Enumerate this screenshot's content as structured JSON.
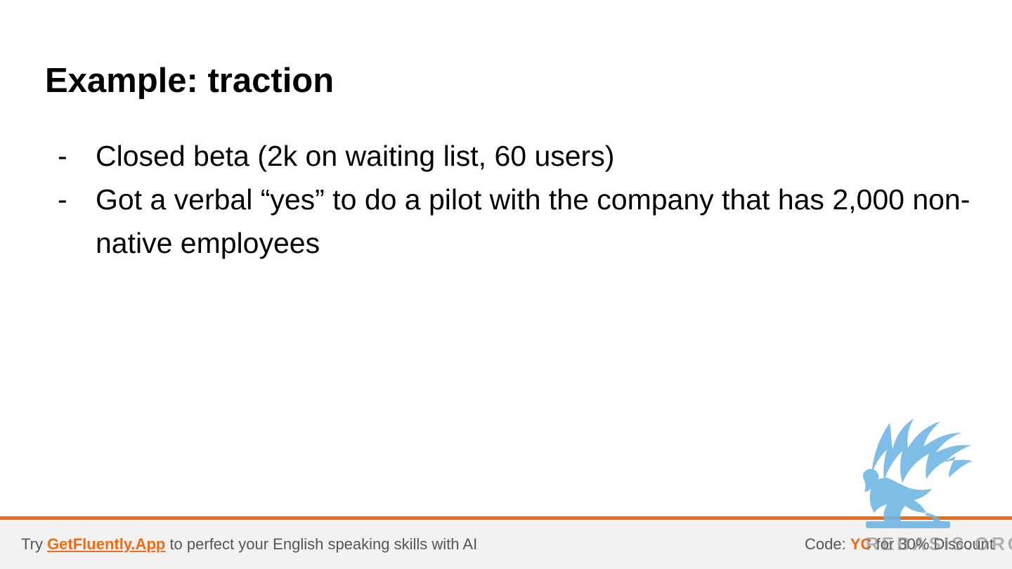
{
  "slide": {
    "title": "Example: traction",
    "bullets": [
      {
        "marker": "-",
        "text": "Closed beta (2k on waiting list, 60 users)"
      },
      {
        "marker": "-",
        "text": "Got a verbal “yes” to do a pilot with the company that has 2,000 non-native employees"
      }
    ]
  },
  "footer": {
    "left_prefix": "Try ",
    "link_text": "GetFluently.App",
    "left_suffix": " to perfect your English speaking skills with AI",
    "right_prefix": "Code: ",
    "code": "YC",
    "right_suffix": " for 30% Discount"
  },
  "watermark": {
    "text": "REBASIS.ORG",
    "icon": "griffin-logo-icon"
  },
  "colors": {
    "accent": "#f26b10",
    "footer_bg": "#f2f2f2",
    "footer_text": "#555555",
    "watermark_blue": "#6fb6e4"
  }
}
